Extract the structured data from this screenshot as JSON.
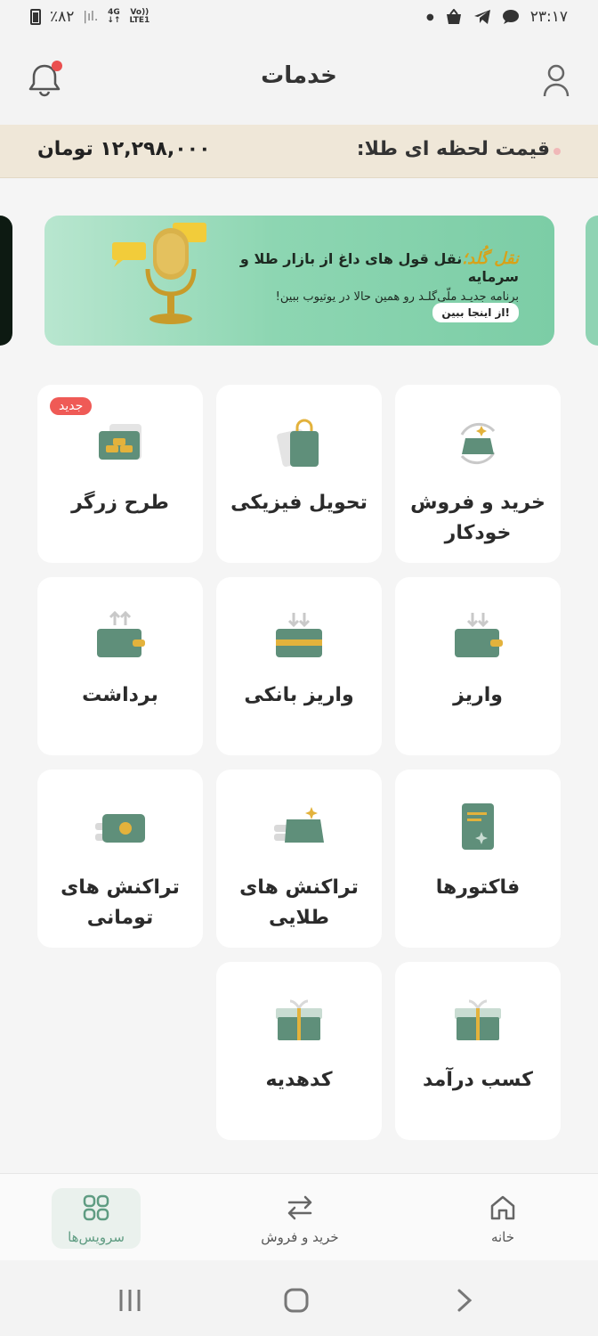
{
  "status_bar": {
    "battery": "٪۸۲",
    "signal_bars": "|ıl.",
    "network_4g": "4G",
    "volte": "Vo))",
    "lte": "LTE1",
    "time": "۲۳:۱۷"
  },
  "header": {
    "title": "خدمات"
  },
  "price_bar": {
    "label": "قیمت لحظه ای طلا:",
    "value": "۱۲,۲۹۸,۰۰۰ تومان"
  },
  "banner": {
    "brand": "نقل گُلد؛",
    "title": "نقل قول های داغ از بازار طلا و سرمایه",
    "subtitle": "برنامه جدیـد ملّی‌گلـد رو همین حالا در یوتیوب ببین!",
    "button": "از اینجا ببین!"
  },
  "services": [
    {
      "label": "خرید و فروش خودکار",
      "icon": "auto-trade-icon"
    },
    {
      "label": "تحویل فیزیکی",
      "icon": "shopping-bag-icon"
    },
    {
      "label": "طرح زرگر",
      "icon": "gold-bars-icon",
      "badge": "جدید"
    },
    {
      "label": "واریز",
      "icon": "deposit-wallet-icon"
    },
    {
      "label": "واریز بانکی",
      "icon": "bank-deposit-icon"
    },
    {
      "label": "برداشت",
      "icon": "withdraw-wallet-icon"
    },
    {
      "label": "فاکتورها",
      "icon": "invoice-icon"
    },
    {
      "label": "تراکنش های طلایی",
      "icon": "gold-transactions-icon"
    },
    {
      "label": "تراکنش های تومانی",
      "icon": "toman-transactions-icon"
    },
    {
      "label": "کسب درآمد",
      "icon": "gift-icon"
    },
    {
      "label": "کدهدیه",
      "icon": "gift-code-icon"
    }
  ],
  "bottom_nav": {
    "home": "خانه",
    "trade": "خرید و فروش",
    "services": "سرویس‌ها",
    "active": "services"
  },
  "colors": {
    "accent_green": "#5f8f7a",
    "gold": "#e3b23c",
    "badge_red": "#ef5a56"
  }
}
